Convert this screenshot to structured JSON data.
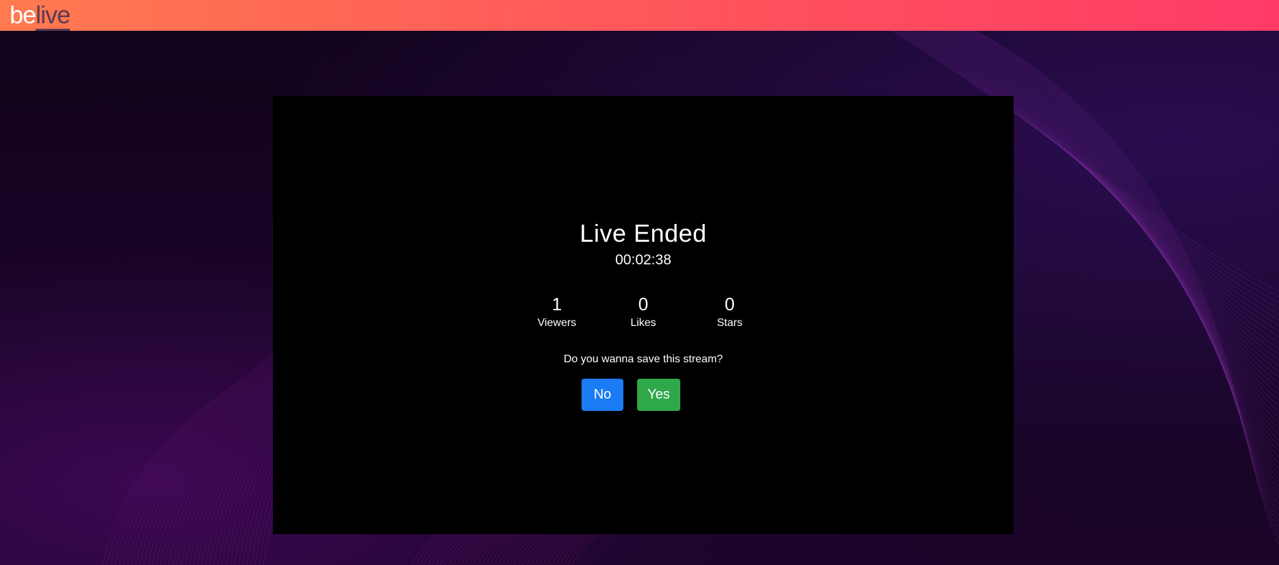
{
  "brand": {
    "logo_part1": "be",
    "logo_part2": "live",
    "gradient_start": "#ff7a4f",
    "gradient_end": "#ff3a66"
  },
  "live_end": {
    "title": "Live Ended",
    "duration": "00:02:38",
    "stats": [
      {
        "value": "1",
        "label": "Viewers"
      },
      {
        "value": "0",
        "label": "Likes"
      },
      {
        "value": "0",
        "label": "Stars"
      }
    ],
    "question": "Do you wanna save this stream?",
    "no_label": "No",
    "yes_label": "Yes",
    "no_color": "#1a7cf5",
    "yes_color": "#2fa84a"
  }
}
